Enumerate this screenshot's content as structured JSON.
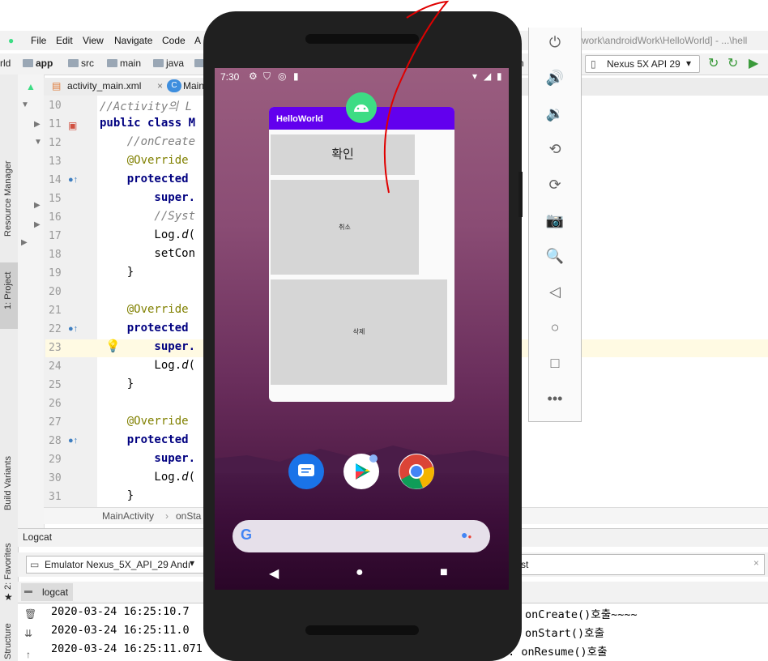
{
  "ide": {
    "title_partial": "work\\androidWork\\HelloWorld] - ...\\hell",
    "menu": [
      "File",
      "Edit",
      "View",
      "Navigate",
      "Code",
      "A"
    ],
    "breadcrumb": [
      "rld",
      "app",
      "src",
      "main",
      "java",
      "c"
    ],
    "device": "Nexus 5X API 29",
    "tabs": [
      "activity_main.xml",
      "Main"
    ],
    "left_tools": [
      "Resource Manager",
      "1: Project",
      "Build Variants",
      "2: Favorites",
      "Structure"
    ],
    "code_lines": [
      {
        "n": "10",
        "parts": [
          {
            "t": "//Activity의 L",
            "c": "cmt"
          }
        ]
      },
      {
        "n": "11",
        "parts": [
          {
            "t": "public class M",
            "c": "kw"
          }
        ]
      },
      {
        "n": "12",
        "parts": [
          {
            "t": "    //onCreate",
            "c": "cmt"
          }
        ]
      },
      {
        "n": "13",
        "parts": [
          {
            "t": "    @Override",
            "c": "ann"
          }
        ]
      },
      {
        "n": "14",
        "parts": [
          {
            "t": "    protected",
            "c": "kw"
          }
        ]
      },
      {
        "n": "15",
        "parts": [
          {
            "t": "        super.",
            "c": "kw"
          }
        ]
      },
      {
        "n": "16",
        "parts": [
          {
            "t": "        //Syst",
            "c": "cmt"
          }
        ]
      },
      {
        "n": "17",
        "parts": [
          {
            "t": "        Log.",
            "c": "plain"
          },
          {
            "t": "d",
            "c": "it"
          },
          {
            "t": "(",
            "c": "plain"
          }
        ]
      },
      {
        "n": "18",
        "parts": [
          {
            "t": "        setCon",
            "c": "plain"
          }
        ]
      },
      {
        "n": "19",
        "parts": [
          {
            "t": "    }",
            "c": "plain"
          }
        ]
      },
      {
        "n": "20",
        "parts": [
          {
            "t": "",
            "c": "plain"
          }
        ]
      },
      {
        "n": "21",
        "parts": [
          {
            "t": "    @Override",
            "c": "ann"
          }
        ]
      },
      {
        "n": "22",
        "parts": [
          {
            "t": "    protected",
            "c": "kw"
          }
        ]
      },
      {
        "n": "23",
        "parts": [
          {
            "t": "        super.",
            "c": "kw"
          }
        ]
      },
      {
        "n": "24",
        "parts": [
          {
            "t": "        Log.",
            "c": "plain"
          },
          {
            "t": "d",
            "c": "it"
          },
          {
            "t": "(",
            "c": "plain"
          }
        ]
      },
      {
        "n": "25",
        "parts": [
          {
            "t": "    }",
            "c": "plain"
          }
        ]
      },
      {
        "n": "26",
        "parts": [
          {
            "t": "",
            "c": "plain"
          }
        ]
      },
      {
        "n": "27",
        "parts": [
          {
            "t": "    @Override",
            "c": "ann"
          }
        ]
      },
      {
        "n": "28",
        "parts": [
          {
            "t": "    protected",
            "c": "kw"
          }
        ]
      },
      {
        "n": "29",
        "parts": [
          {
            "t": "        super.",
            "c": "kw"
          }
        ]
      },
      {
        "n": "30",
        "parts": [
          {
            "t": "        Log.",
            "c": "plain"
          },
          {
            "t": "d",
            "c": "it"
          },
          {
            "t": "(",
            "c": "plain"
          }
        ]
      },
      {
        "n": "31",
        "parts": [
          {
            "t": "    }",
            "c": "plain"
          }
        ]
      }
    ],
    "code_breadcrumb": [
      "MainActivity",
      "onSta"
    ],
    "logcat": {
      "title": "Logcat",
      "device_select": "Emulator Nexus_5X_API_29 Andı",
      "filter_partial": "st",
      "tab": "logcat",
      "lines": [
        {
          "ts": "2020-03-24 16:25:10.7",
          "msg": "onCreate()호출~~~~"
        },
        {
          "ts": "2020-03-24 16:25:11.0",
          "msg": "onStart()호출"
        },
        {
          "ts": "2020-03-24 16:25:11.071",
          "msg": "t: onResume()호출"
        }
      ]
    }
  },
  "emulator_toolbar": [
    "power-icon",
    "volume-up-icon",
    "volume-down-icon",
    "rotate-left-icon",
    "rotate-right-icon",
    "camera-icon",
    "zoom-icon",
    "back-icon",
    "home-icon",
    "overview-icon",
    "more-icon"
  ],
  "phone": {
    "time": "7:30",
    "recent_app": {
      "title": "HelloWorld",
      "buttons": [
        "확인",
        "취소",
        "삭제"
      ]
    },
    "dock_apps": [
      "messages-icon",
      "play-store-icon",
      "chrome-icon"
    ],
    "accent": "#6200ee"
  }
}
